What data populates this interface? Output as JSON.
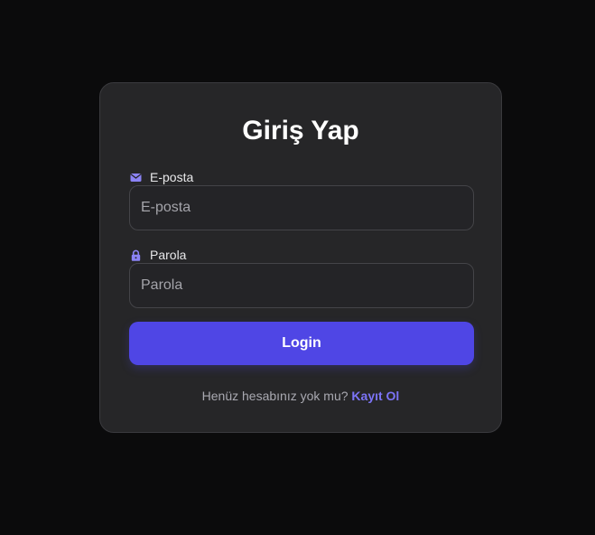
{
  "login_form": {
    "title": "Giriş Yap",
    "email": {
      "label": "E-posta",
      "icon": "envelope-icon",
      "placeholder": "E-posta",
      "value": ""
    },
    "password": {
      "label": "Parola",
      "icon": "lock-icon",
      "placeholder": "Parola",
      "value": ""
    },
    "submit_label": "Login",
    "footer_text": "Henüz hesabınız yok mu?",
    "register_link": "Kayıt Ol"
  },
  "colors": {
    "background": "#0b0b0c",
    "card": "#262628",
    "accent": "#4f46e5",
    "link": "#7c74f7",
    "icon": "#8b83f5"
  }
}
